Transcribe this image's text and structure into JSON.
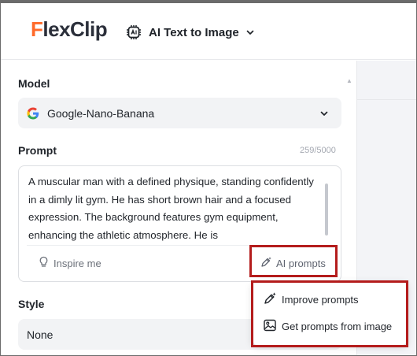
{
  "header": {
    "logo_prefix": "F",
    "logo_rest": "lexClip",
    "tool_label": "AI Text to Image"
  },
  "model": {
    "label": "Model",
    "selected": "Google-Nano-Banana"
  },
  "prompt": {
    "label": "Prompt",
    "counter": "259/5000",
    "text": "A muscular man with a defined physique, standing confidently in a dimly lit gym. He has short brown hair and a focused expression. The background features gym equipment, enhancing the athletic atmosphere. He is",
    "inspire_label": "Inspire me",
    "ai_prompts_label": "AI prompts"
  },
  "style": {
    "label": "Style",
    "selected": "None"
  },
  "menu": {
    "items": [
      {
        "label": "Improve prompts",
        "icon": "improve-pen-icon"
      },
      {
        "label": "Get prompts from image",
        "icon": "image-icon"
      }
    ]
  },
  "colors": {
    "logo_accent": "#ff6a2a",
    "highlight": "#b41c1c"
  }
}
